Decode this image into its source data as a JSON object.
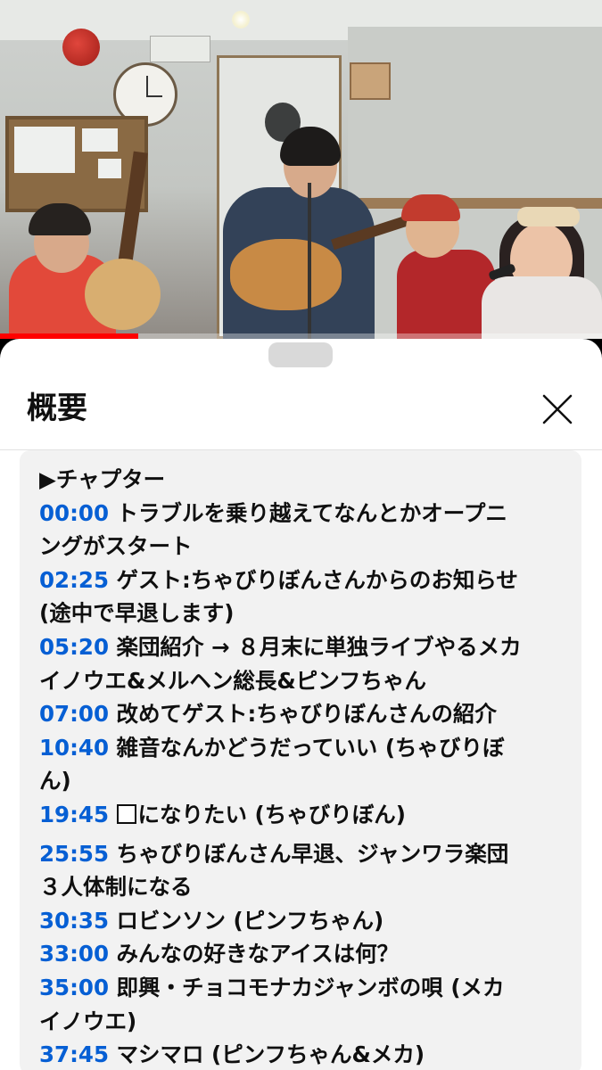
{
  "video": {
    "progress_fraction": 0.23,
    "progress_color": "#ff0000"
  },
  "sheet": {
    "title": "概要",
    "close_icon": "close-icon"
  },
  "description": {
    "chapter_heading": "▶チャプター",
    "chapters": [
      {
        "time": "00:00",
        "lines": [
          "トラブルを乗り越えてなんとかオープニ",
          "ングがスタート"
        ]
      },
      {
        "time": "02:25",
        "lines": [
          "ゲスト:ちゃびりぼんさんからのお知らせ",
          "(途中で早退します)"
        ]
      },
      {
        "time": "05:20",
        "lines": [
          "楽団紹介 → ８月末に単独ライブやるメカ",
          "イノウエ&メルヘン総長&ピンフちゃん"
        ]
      },
      {
        "time": "07:00",
        "lines": [
          "改めてゲスト:ちゃびりぼんさんの紹介"
        ]
      },
      {
        "time": "10:40",
        "lines": [
          "雑音なんかどうだっていい (ちゃびりぼ",
          "ん)"
        ]
      },
      {
        "time": "19:45",
        "lines": [
          "になりたい (ちゃびりぼん)"
        ],
        "box_glyph": true
      },
      {
        "time": "25:55",
        "lines": [
          "ちゃびりぼんさん早退、ジャンワラ楽団",
          "３人体制になる"
        ]
      },
      {
        "time": "30:35",
        "lines": [
          "ロビンソン (ピンフちゃん)"
        ]
      },
      {
        "time": "33:00",
        "lines": [
          "みんなの好きなアイスは何？"
        ]
      },
      {
        "time": "35:00",
        "lines": [
          "即興・チョコモナカジャンボの唄 (メカ",
          "イノウエ)"
        ]
      },
      {
        "time": "37:45",
        "lines": [
          "マシマロ (ピンフちゃん&メカ)"
        ]
      }
    ]
  },
  "colors": {
    "timestamp_link": "#065fd4",
    "sheet_bg": "#ffffff",
    "description_bg": "#f2f2f2"
  }
}
